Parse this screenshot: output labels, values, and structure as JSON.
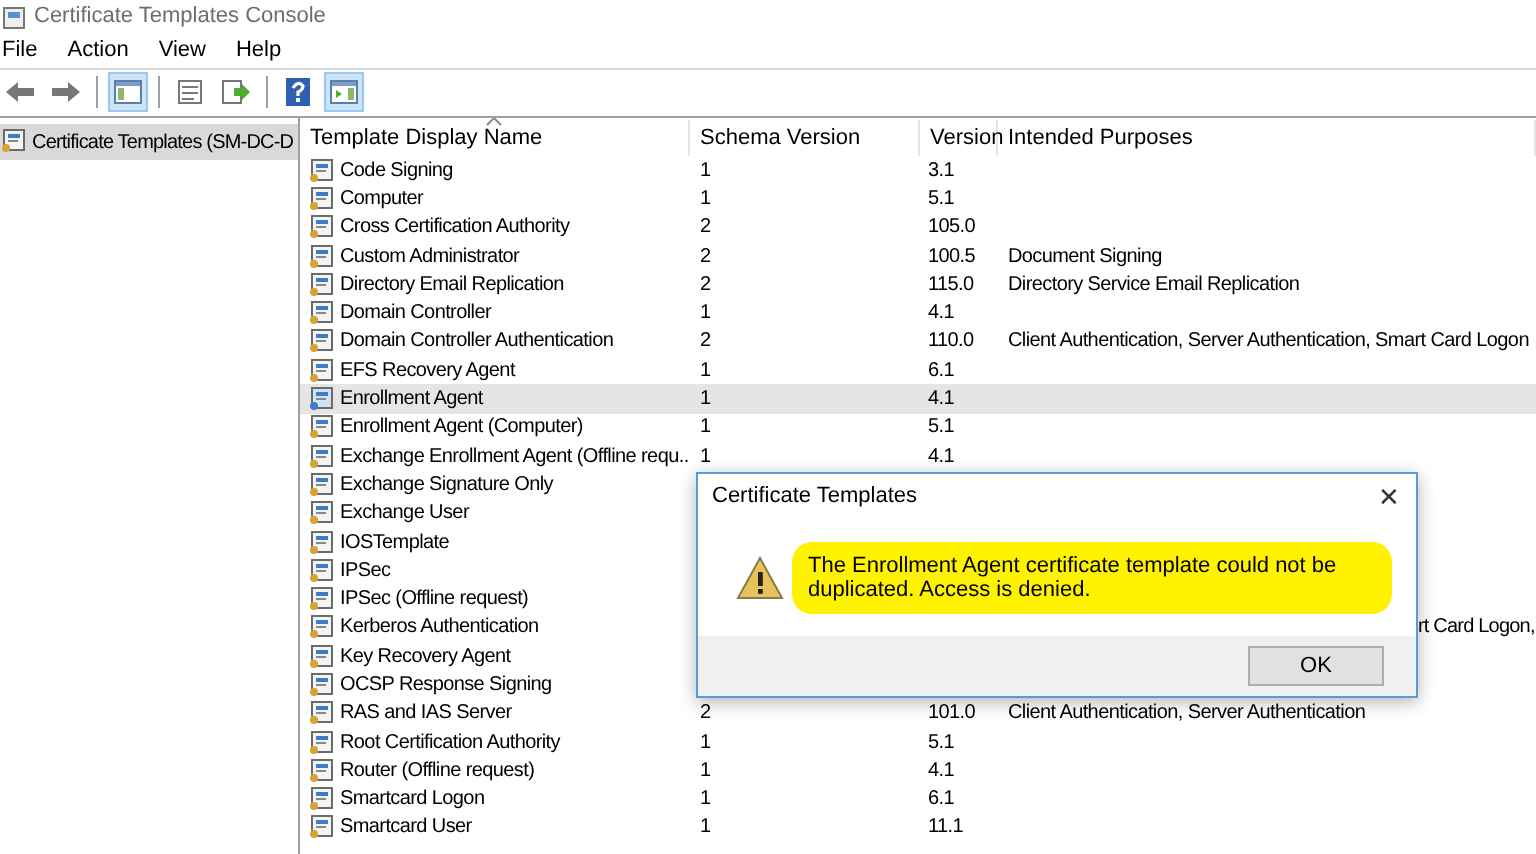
{
  "window": {
    "title": "Certificate Templates Console"
  },
  "menu": [
    "File",
    "Action",
    "View",
    "Help"
  ],
  "toolbar": [
    {
      "kind": "back",
      "pressed": false
    },
    {
      "kind": "forward",
      "pressed": false
    },
    {
      "kind": "separator"
    },
    {
      "kind": "tree",
      "pressed": true
    },
    {
      "kind": "separator"
    },
    {
      "kind": "properties",
      "pressed": false
    },
    {
      "kind": "export",
      "pressed": false
    },
    {
      "kind": "separator"
    },
    {
      "kind": "help",
      "pressed": false
    },
    {
      "kind": "pane",
      "pressed": true
    }
  ],
  "tree": {
    "items": [
      {
        "label": "Certificate Templates (SM-DC-D",
        "selected": true
      }
    ]
  },
  "table": {
    "columns": [
      {
        "label": "Template Display Name",
        "sorted": true
      },
      {
        "label": "Schema Version",
        "sorted": false
      },
      {
        "label": "Version",
        "sorted": false
      },
      {
        "label": "Intended Purposes",
        "sorted": false
      }
    ],
    "rows": [
      {
        "name": "Code Signing",
        "schema": "1",
        "version": "3.1",
        "selected": false
      },
      {
        "name": "Computer",
        "schema": "1",
        "version": "5.1",
        "selected": false
      },
      {
        "name": "Cross Certification Authority",
        "schema": "2",
        "version": "105.0",
        "selected": false
      },
      {
        "name": "Custom Administrator",
        "schema": "2",
        "version": "100.5",
        "purposes": "Document Signing",
        "selected": false
      },
      {
        "name": "Directory Email Replication",
        "schema": "2",
        "version": "115.0",
        "purposes": "Directory Service Email Replication",
        "selected": false
      },
      {
        "name": "Domain Controller",
        "schema": "1",
        "version": "4.1",
        "selected": false
      },
      {
        "name": "Domain Controller Authentication",
        "schema": "2",
        "version": "110.0",
        "purposes": "Client Authentication, Server Authentication, Smart Card Logon",
        "selected": false
      },
      {
        "name": "EFS Recovery Agent",
        "schema": "1",
        "version": "6.1",
        "selected": false
      },
      {
        "name": "Enrollment Agent",
        "schema": "1",
        "version": "4.1",
        "selected": true
      },
      {
        "name": "Enrollment Agent (Computer)",
        "schema": "1",
        "version": "5.1",
        "selected": false
      },
      {
        "name": "Exchange Enrollment Agent (Offline requ...",
        "schema": "1",
        "version": "4.1",
        "selected": false
      },
      {
        "name": "Exchange Signature Only",
        "selected": false
      },
      {
        "name": "Exchange User",
        "selected": false
      },
      {
        "name": "IOSTemplate",
        "selected": false
      },
      {
        "name": "IPSec",
        "selected": false
      },
      {
        "name": "IPSec (Offline request)",
        "selected": false
      },
      {
        "name": "Kerberos Authentication",
        "purposes_tail": "rt Card Logon,",
        "selected": false
      },
      {
        "name": "Key Recovery Agent",
        "selected": false
      },
      {
        "name": "OCSP Response Signing",
        "selected": false
      },
      {
        "name": "RAS and IAS Server",
        "schema": "2",
        "version": "101.0",
        "purposes": "Client Authentication, Server Authentication",
        "selected": false
      },
      {
        "name": "Root Certification Authority",
        "schema": "1",
        "version": "5.1",
        "selected": false
      },
      {
        "name": "Router (Offline request)",
        "schema": "1",
        "version": "4.1",
        "selected": false
      },
      {
        "name": "Smartcard Logon",
        "schema": "1",
        "version": "6.1",
        "selected": false
      },
      {
        "name": "Smartcard User",
        "schema": "1",
        "version": "11.1",
        "selected": false
      }
    ]
  },
  "dialog": {
    "title": "Certificate Templates",
    "close": "✕",
    "message": "The Enrollment Agent certificate template could not be duplicated. Access is denied.",
    "highlighted": true,
    "button": "OK"
  }
}
